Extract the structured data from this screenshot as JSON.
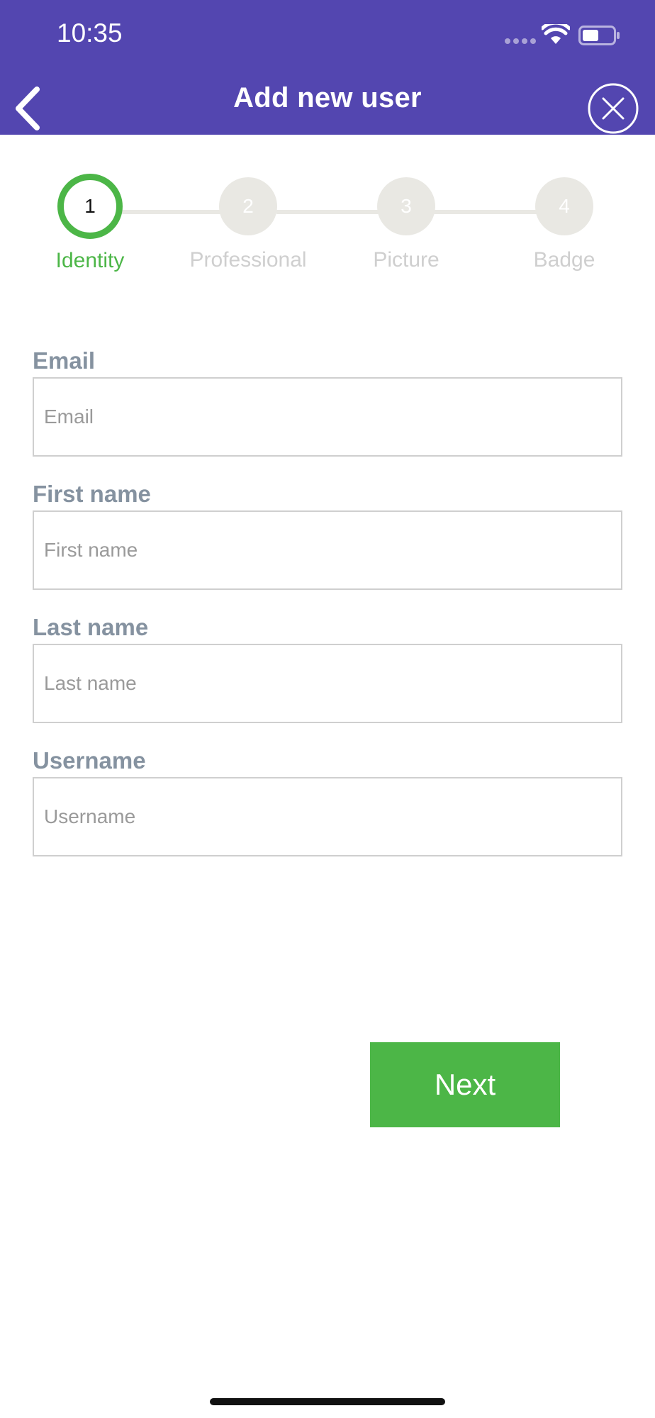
{
  "status_bar": {
    "time": "10:35"
  },
  "header": {
    "title": "Add new user",
    "back_icon": "chevron-left-icon",
    "close_icon": "close-circle-icon",
    "background_color": "#5346B0"
  },
  "stepper": {
    "active_index": 0,
    "active_color": "#4CB647",
    "steps": [
      {
        "number": "1",
        "label": "Identity"
      },
      {
        "number": "2",
        "label": "Professional"
      },
      {
        "number": "3",
        "label": "Picture"
      },
      {
        "number": "4",
        "label": "Badge"
      }
    ]
  },
  "form": {
    "fields": [
      {
        "label": "Email",
        "placeholder": "Email",
        "value": ""
      },
      {
        "label": "First name",
        "placeholder": "First name",
        "value": ""
      },
      {
        "label": "Last name",
        "placeholder": "Last name",
        "value": ""
      },
      {
        "label": "Username",
        "placeholder": "Username",
        "value": ""
      }
    ]
  },
  "actions": {
    "next_label": "Next",
    "next_color": "#4CB647"
  }
}
